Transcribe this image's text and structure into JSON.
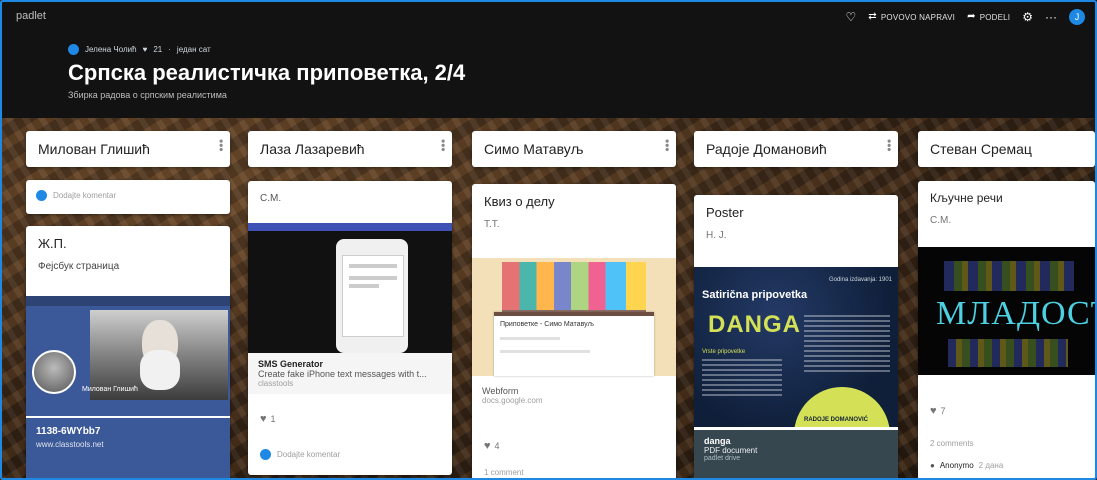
{
  "app": {
    "brand": "padlet"
  },
  "toolbar": {
    "heart_icon": "heart-icon",
    "remake_label": "POVOVO NAPRAVI",
    "share_label": "PODELI",
    "more_label": "···",
    "avatar_letter": "J"
  },
  "board": {
    "author": "Јелена Чолић",
    "likes": "21",
    "time": "један сат",
    "title": "Српска реалистичка приповетка, 2/4",
    "subtitle": "Збирка радова о српским реалистима"
  },
  "columns": [
    {
      "header": "Милован Глишић",
      "comment_prompt": "Dodajte komentar",
      "cards": [
        {
          "title": "Ж.П.",
          "subtitle": "Фејсбук страница",
          "image_caption": "Милован Глишић",
          "link_title": "1138-6WYbb7",
          "link_url": "www.classtools.net"
        }
      ]
    },
    {
      "header": "Лаза Лазаревић",
      "cards": [
        {
          "author": "С.М.",
          "link_title": "SMS Generator",
          "link_desc": "Create fake iPhone text messages with t...",
          "link_source": "classtools",
          "likes": "1",
          "comment_prompt": "Dodajte komentar"
        }
      ]
    },
    {
      "header": "Симо Матавуљ",
      "cards": [
        {
          "title": "Квиз о делу",
          "author": "Т.Т.",
          "form_title": "Приповетке - Симо Матавуљ",
          "link_title": "Webform",
          "link_source": "docs.google.com",
          "likes": "4",
          "comments": "1 comment"
        }
      ]
    },
    {
      "header": "Радоје Домановић",
      "cards": [
        {
          "title": "Poster",
          "author": "Н. Ј.",
          "poster_header": "Satirična pripovetka",
          "poster_year": "Godina izdavanja: 1901",
          "poster_title": "DANGA",
          "poster_sub": "Vrste pripovetke",
          "poster_bottom": "RADOJE DOMANOVIĆ",
          "link_title": "danga",
          "link_desc": "PDF document",
          "link_source": "padlet drive"
        }
      ]
    },
    {
      "header": "Стеван Сремац",
      "cards": [
        {
          "title": "Кључне речи",
          "author": "С.М.",
          "cloud_main": "МЛАДОСТ",
          "likes": "7",
          "comments": "2 comments",
          "commenter": "Anonymo",
          "comment_time": "2 дана"
        }
      ]
    }
  ],
  "colors": {
    "accent": "#1e88e5",
    "topbar": "#121212",
    "poster_bg": "#0f1f3a",
    "poster_accent": "#d4e157"
  }
}
